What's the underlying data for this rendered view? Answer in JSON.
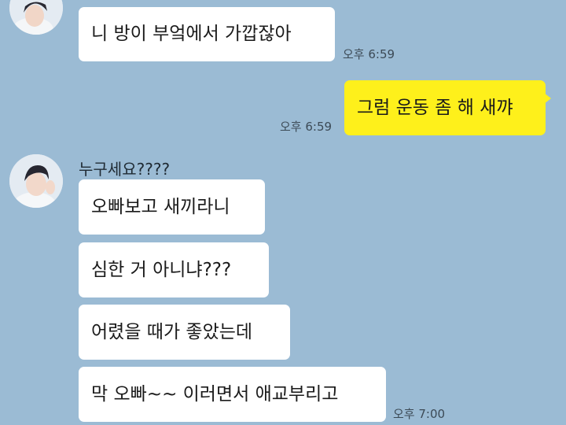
{
  "conversation": {
    "block1": {
      "messages": [
        "니 방이 부엌에서 가깝잖아"
      ],
      "time": "오후 6:59"
    },
    "mine": {
      "messages": [
        "그럼 운동 좀 해 새꺄"
      ],
      "time": "오후 6:59"
    },
    "block2": {
      "sender": "누구세요????",
      "messages": [
        "오빠보고 새끼라니",
        "심한 거 아니냐???",
        "어렸을 때가 좋았는데",
        "막 오빠~~ 이러면서 애교부리고"
      ],
      "time": "오후 7:00"
    }
  },
  "colors": {
    "background": "#9bbbd4",
    "other_bubble": "#ffffff",
    "my_bubble": "#fef01b"
  }
}
